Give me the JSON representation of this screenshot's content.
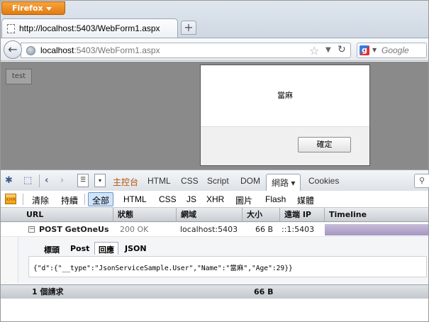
{
  "browser": {
    "menu_button_label": "Firefox",
    "tab_title": "http://localhost:5403/WebForm1.aspx",
    "new_tab_label": "+",
    "url_host": "localhost",
    "url_path": ":5403/WebForm1.aspx",
    "search_placeholder": "Google",
    "back_glyph": "←",
    "reload_glyph": "↻",
    "star_glyph": "☆"
  },
  "page": {
    "test_button_label": "test",
    "dialog": {
      "message": "當麻",
      "ok_label": "確定"
    }
  },
  "firebug": {
    "tabs": [
      {
        "label": "主控台",
        "active": false
      },
      {
        "label": "HTML",
        "active": false
      },
      {
        "label": "CSS",
        "active": false
      },
      {
        "label": "Script",
        "active": false
      },
      {
        "label": "DOM",
        "active": false
      },
      {
        "label": "網路 ▾",
        "active": true
      },
      {
        "label": "Cookies",
        "active": false
      }
    ],
    "net_toolbar": {
      "clear_label": "清除",
      "persist_label": "持續",
      "filters": [
        "全部",
        "HTML",
        "CSS",
        "JS",
        "XHR",
        "圖片",
        "Flash",
        "媒體"
      ],
      "selected_filter": "全部"
    },
    "columns": [
      "URL",
      "狀態",
      "網域",
      "大小",
      "遠端 IP",
      "Timeline"
    ],
    "request": {
      "url": "POST GetOneUser",
      "status": "200 OK",
      "domain": "localhost:5403",
      "size": "66 B",
      "remote_ip": "::1:5403"
    },
    "detail_tabs": [
      "標頭",
      "Post",
      "回應",
      "JSON"
    ],
    "selected_detail_tab": "回應",
    "response_body": "{\"d\":{\"__type\":\"JsonServiceSample.User\",\"Name\":\"當麻\",\"Age\":29}}",
    "summary": {
      "count_label": "1 個請求",
      "total_size": "66 B"
    }
  },
  "colors": {
    "firefox_button": "#e27b11",
    "overlay": "#8a8a8a",
    "timeline_bar": "#a596c0",
    "selected_filter_bg": "#cfe3fb"
  }
}
